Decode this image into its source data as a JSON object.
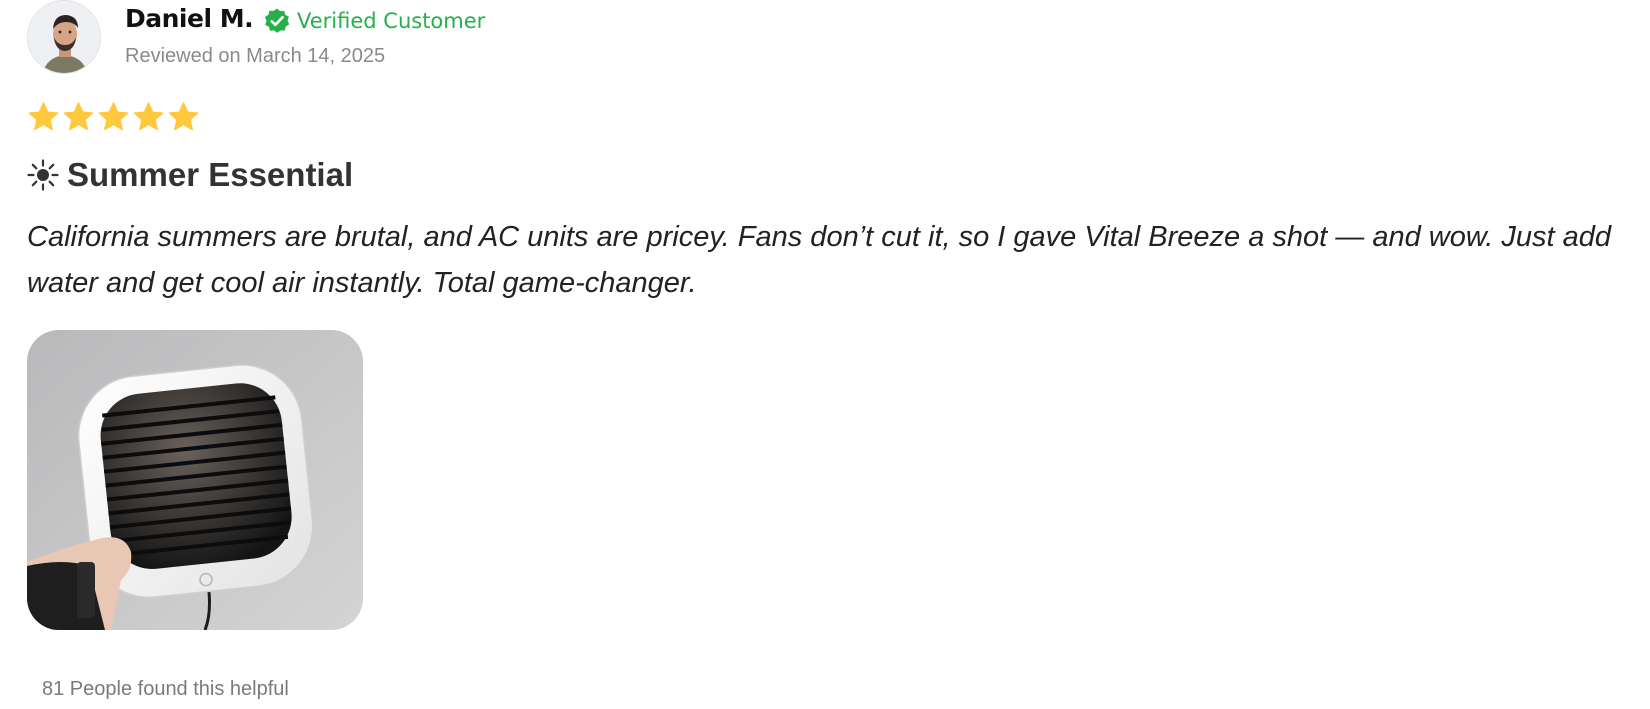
{
  "reviewer": {
    "name": "Daniel M.",
    "verified_label": "Verified Customer",
    "review_date": "Reviewed on March 14, 2025",
    "avatar_icon": "user-avatar-photo"
  },
  "rating": {
    "value": 5,
    "max": 5,
    "star_color": "#FFC83D"
  },
  "review": {
    "title_icon": "sun-icon",
    "title": "Summer Essential",
    "body": "California summers are brutal, and AC units are pricey. Fans don’t cut it, so I gave Vital Breeze a shot — and wow. Just add water and get cool air instantly. Total game-changer."
  },
  "photo": {
    "subject": "portable-air-cooler-photo"
  },
  "helpful": {
    "text": "81 People found this helpful"
  },
  "colors": {
    "verified_green": "#26B04A",
    "muted_text": "#8A8A8A",
    "title_text": "#333333"
  }
}
